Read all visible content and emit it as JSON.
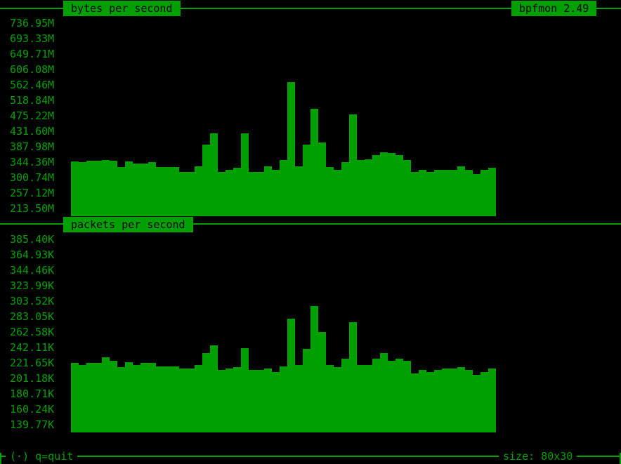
{
  "app": {
    "title": "bpfmon 2.49"
  },
  "panels": {
    "bytes": {
      "title": "bytes per second",
      "y_labels": [
        "736.95M",
        "693.33M",
        "649.71M",
        "606.08M",
        "562.46M",
        "518.84M",
        "475.22M",
        "431.60M",
        "387.98M",
        "344.36M",
        "300.74M",
        "257.12M",
        "213.50M"
      ]
    },
    "packets": {
      "title": "packets per second",
      "y_labels": [
        "385.40K",
        "364.93K",
        "344.46K",
        "323.99K",
        "303.52K",
        "283.05K",
        "262.58K",
        "242.11K",
        "221.65K",
        "201.18K",
        "180.71K",
        "160.24K",
        "139.77K"
      ]
    }
  },
  "footer": {
    "left": "(·) q=quit",
    "right": "size: 80x30"
  },
  "chart_data": [
    {
      "type": "bar",
      "title": "bytes per second",
      "ylabel": "",
      "ylim": [
        213.5,
        736.95
      ],
      "unit": "M",
      "values": [
        347,
        345,
        348,
        348,
        350,
        348,
        330,
        347,
        340,
        340,
        345,
        330,
        330,
        330,
        317,
        317,
        333,
        393,
        425,
        317,
        322,
        328,
        425,
        317,
        317,
        333,
        322,
        350,
        570,
        333,
        393,
        495,
        400,
        330,
        322,
        345,
        480,
        350,
        353,
        365,
        373,
        370,
        365,
        350,
        317,
        322,
        317,
        322,
        322,
        322,
        333,
        322,
        310,
        322,
        328
      ]
    },
    {
      "type": "bar",
      "title": "packets per second",
      "ylabel": "",
      "ylim": [
        139.77,
        385.4
      ],
      "unit": "K",
      "values": [
        221.7,
        219,
        221.7,
        221.7,
        229,
        224,
        216,
        223,
        219,
        221.7,
        221.7,
        217,
        217,
        217,
        214,
        214,
        219,
        235,
        245,
        212,
        214,
        216,
        241,
        212,
        212,
        214,
        210,
        217,
        280,
        219,
        240,
        297,
        263,
        219,
        216,
        227,
        276,
        219,
        219,
        227,
        235,
        224,
        227,
        224,
        208,
        212,
        210,
        212,
        214,
        214,
        216,
        212,
        206,
        210,
        214
      ]
    }
  ]
}
